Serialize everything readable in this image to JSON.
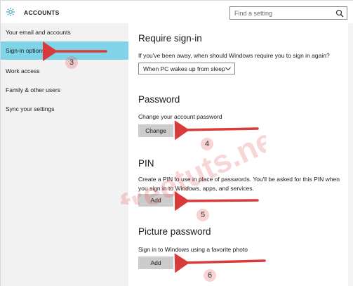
{
  "header": {
    "title": "ACCOUNTS",
    "search_placeholder": "Find a setting",
    "icon": "gear-icon"
  },
  "sidebar": {
    "items": [
      {
        "label": "Your email and accounts",
        "active": false
      },
      {
        "label": "Sign-in options",
        "active": true
      },
      {
        "label": "Work access",
        "active": false
      },
      {
        "label": "Family & other users",
        "active": false
      },
      {
        "label": "Sync your settings",
        "active": false
      }
    ]
  },
  "main": {
    "require_signin": {
      "title": "Require sign-in",
      "desc": "If you've been away, when should Windows require you to sign in again?",
      "dropdown_value": "When PC wakes up from sleep"
    },
    "password": {
      "title": "Password",
      "desc": "Change your account password",
      "button": "Change"
    },
    "pin": {
      "title": "PIN",
      "desc": "Create a PIN to use in place of passwords. You'll be asked for this PIN when you sign in to Windows, apps, and services.",
      "button": "Add"
    },
    "picture_password": {
      "title": "Picture password",
      "desc": "Sign in to Windows using a favorite photo",
      "button": "Add"
    }
  },
  "annotations": {
    "steps": [
      "3",
      "4",
      "5",
      "6"
    ],
    "watermark": "freetuts.net"
  },
  "colors": {
    "accent": "#7fd4e8",
    "arrow": "#d93a3a",
    "button_bg": "#cccccc",
    "sidebar_bg": "#f2f2f2"
  }
}
